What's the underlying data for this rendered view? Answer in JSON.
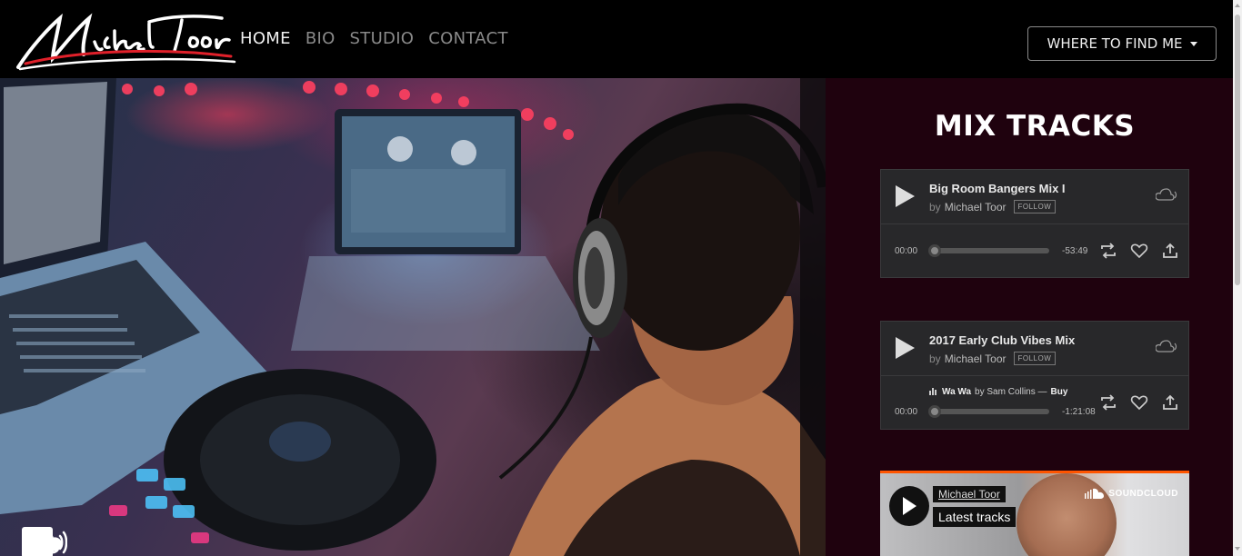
{
  "nav": {
    "logo_text": "Michael Toor",
    "links": [
      {
        "label": "HOME",
        "active": true
      },
      {
        "label": "BIO"
      },
      {
        "label": "STUDIO"
      },
      {
        "label": "CONTACT"
      }
    ],
    "dropdown_label": "WHERE TO FIND ME"
  },
  "social": [
    "facebook-icon",
    "instagram-icon",
    "snapchat-icon",
    "soundcloud-icon",
    "mixcloud-icon"
  ],
  "panel": {
    "title": "MIX TRACKS",
    "tracks": [
      {
        "title": "Big Room Bangers Mix I",
        "by": "by",
        "artist": "Michael Toor",
        "follow": "FOLLOW",
        "time_start": "00:00",
        "time_end": "-53:49"
      },
      {
        "title": "2017 Early Club Vibes Mix",
        "by": "by",
        "artist": "Michael Toor",
        "follow": "FOLLOW",
        "now_track": "Wa Wa",
        "now_by": "by Sam Collins —",
        "now_buy": "Buy",
        "time_start": "00:00",
        "time_end": "-1:21:08"
      }
    ],
    "widget": {
      "user": "Michael Toor",
      "label": "Latest tracks",
      "brand": "SOUNDCLOUD"
    }
  },
  "colors": {
    "panel_bg": "#1f020e",
    "accent": "#ff5500",
    "logo_red": "#e0202a"
  }
}
